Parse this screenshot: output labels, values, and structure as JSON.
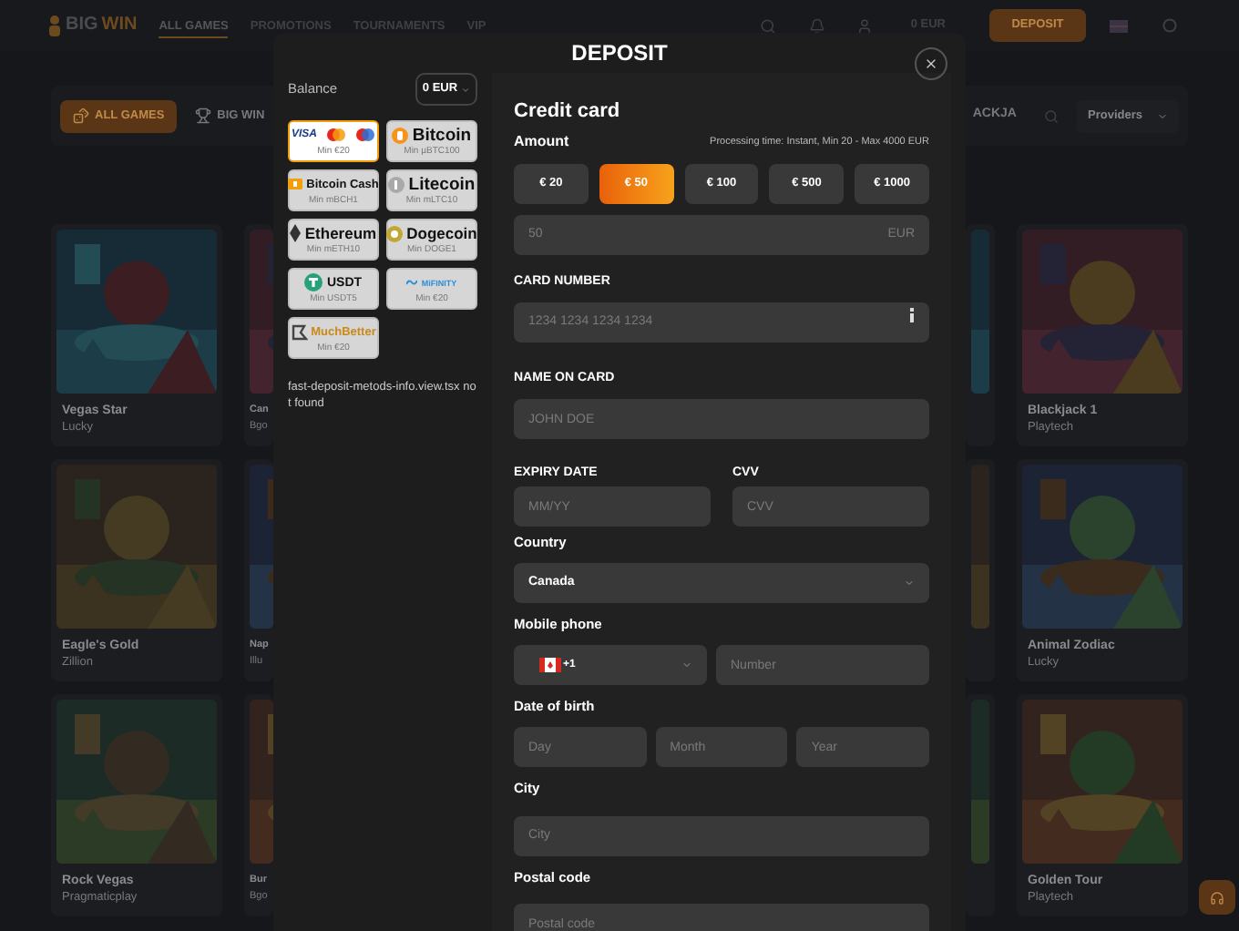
{
  "header": {
    "logo": {
      "part_1": "BIG",
      "part_2": "WIN"
    },
    "nav": [
      {
        "label": "ALL GAMES",
        "selected": true
      },
      {
        "label": "PROMOTIONS",
        "selected": false
      },
      {
        "label": "TOURNAMENTS",
        "selected": false
      },
      {
        "label": "VIP",
        "selected": false
      }
    ],
    "balance": "0 EUR",
    "deposit_button": "DEPOSIT"
  },
  "category_bar": {
    "tabs": [
      {
        "label": "ALL GAMES",
        "selected": true
      },
      {
        "label": "BIG WIN",
        "selected": false
      }
    ],
    "cut_tab": "ACKJA",
    "providers": "Providers"
  },
  "game_columns": [
    {
      "cards": [
        {
          "kind": "full",
          "name": "Vegas Star",
          "provider": "Lucky"
        },
        {
          "kind": "full",
          "name": "Eagle's Gold",
          "provider": "Zillion"
        },
        {
          "kind": "full",
          "name": "Rock Vegas",
          "provider": "Pragmaticplay"
        }
      ]
    },
    {
      "cards": [
        {
          "kind": "full",
          "name": "Can",
          "provider": "Bgo"
        },
        {
          "kind": "full",
          "name": "Nap",
          "provider": "Illu"
        },
        {
          "kind": "full",
          "name": "Bur",
          "provider": "Bgo"
        }
      ]
    },
    {
      "cards": [
        {
          "kind": "picture"
        },
        {
          "kind": "picture"
        },
        {
          "kind": "picture"
        }
      ]
    },
    {
      "cards": [
        {
          "kind": "full",
          "name": "Blackjack 1",
          "provider": "Playtech"
        },
        {
          "kind": "full",
          "name": "Animal Zodiac",
          "provider": "Lucky"
        },
        {
          "kind": "full",
          "name": "Golden Tour",
          "provider": "Playtech"
        }
      ]
    }
  ],
  "modal": {
    "title": "DEPOSIT",
    "balance_label": "Balance",
    "balance_currency": "0 EUR",
    "methods": [
      {
        "kind": "card",
        "label": "VISA",
        "min": "Min €20",
        "selected": true
      },
      {
        "kind": "bitcoin",
        "label": "Bitcoin",
        "min": "Min µBTC100",
        "selected": false
      },
      {
        "kind": "bitcoin_cash",
        "label": "Bitcoin Cash",
        "min": "Min mBCH1",
        "selected": false
      },
      {
        "kind": "litecoin",
        "label": "Litecoin",
        "min": "Min mLTC10",
        "selected": false
      },
      {
        "kind": "ethereum",
        "label": "Ethereum",
        "min": "Min mETH10",
        "selected": false
      },
      {
        "kind": "dogecoin",
        "label": "Dogecoin",
        "min": "Min DOGE1",
        "selected": false
      },
      {
        "kind": "usdt",
        "label": "USDT",
        "min": "Min USDT5",
        "selected": false
      },
      {
        "kind": "mifinity",
        "label": "MiFINITY",
        "min": "Min €20",
        "selected": false
      },
      {
        "kind": "muchbetter",
        "label": "MuchBetter",
        "min": "Min €20",
        "selected": false
      }
    ],
    "missing_notice": "fast-deposit-metods-info.view.tsx not found",
    "form": {
      "title": "Credit card",
      "amount_label": "Amount",
      "processing_info": "Processing time: Instant, Min 20 - Max 4000 EUR",
      "amount_options": [
        {
          "label": "€ 20",
          "selected": false
        },
        {
          "label": "€ 50",
          "selected": true
        },
        {
          "label": "€ 100",
          "selected": false
        },
        {
          "label": "€ 500",
          "selected": false
        },
        {
          "label": "€ 1000",
          "selected": false
        }
      ],
      "amount_value": "50",
      "amount_currency": "EUR",
      "card_number": {
        "label": "CARD NUMBER",
        "placeholder": "1234 1234 1234 1234"
      },
      "name_on_card": {
        "label": "NAME ON CARD",
        "placeholder": "JOHN DOE"
      },
      "expiry_date": {
        "label": "EXPIRY DATE",
        "placeholder": "MM/YY"
      },
      "cvv": {
        "label": "CVV",
        "placeholder": "CVV"
      },
      "country": {
        "label": "Country",
        "value": "Canada"
      },
      "mobile_phone": {
        "label": "Mobile phone",
        "code": "+1",
        "placeholder": "Number"
      },
      "date_of_birth": {
        "label": "Date of birth",
        "day_placeholder": "Day",
        "month_placeholder": "Month",
        "year_placeholder": "Year"
      },
      "city": {
        "label": "City",
        "placeholder": "City"
      },
      "postal_code": {
        "label": "Postal code",
        "placeholder": "Postal code"
      }
    }
  }
}
